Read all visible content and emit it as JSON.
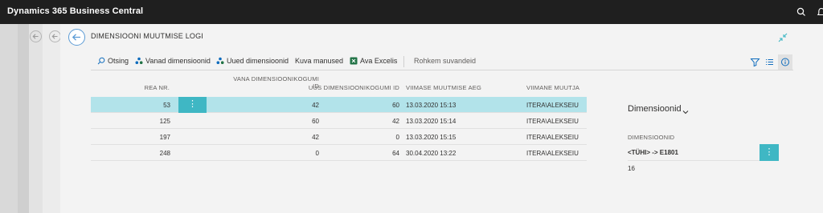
{
  "app": {
    "title": "Dynamics 365 Business Central"
  },
  "page": {
    "title": "DIMENSIOONI MUUTMISE LOGI"
  },
  "toolbar": {
    "items": [
      {
        "label": "Otsing",
        "icon": "search-icon"
      },
      {
        "label": "Vanad dimensioonid",
        "icon": "dimensions-icon"
      },
      {
        "label": "Uued dimensioonid",
        "icon": "dimensions-icon"
      },
      {
        "label": "Kuva manused",
        "icon": ""
      },
      {
        "label": "Ava Excelis",
        "icon": "excel-icon"
      }
    ],
    "more_label": "Rohkem suvandeid"
  },
  "grid": {
    "columns": {
      "line_no": "REA NR.",
      "old_dim_set_1": "VANA DIMENSIOONIKOGUMI",
      "old_dim_set_2": "ID",
      "new_dim_set": "UUS DIMENSIOONIKOGUMI ID",
      "last_modified": "VIIMASE MUUTMISE AEG",
      "last_modifier": "VIIMANE MUUTJA"
    },
    "rows": [
      {
        "line_no": "53",
        "old_id": "42",
        "new_id": "60",
        "modified": "13.03.2020 15:13",
        "user": "ITERA\\ALEKSEIU"
      },
      {
        "line_no": "125",
        "old_id": "60",
        "new_id": "42",
        "modified": "13.03.2020 15:14",
        "user": "ITERA\\ALEKSEIU"
      },
      {
        "line_no": "197",
        "old_id": "42",
        "new_id": "0",
        "modified": "13.03.2020 15:15",
        "user": "ITERA\\ALEKSEIU"
      },
      {
        "line_no": "248",
        "old_id": "0",
        "new_id": "64",
        "modified": "30.04.2020 13:22",
        "user": "ITERA\\ALEKSEIU"
      }
    ],
    "row_menu_glyph": "⋮"
  },
  "factbox": {
    "title": "Dimensioonid",
    "column": "DIMENSIOONID",
    "rows": [
      "<TÜHI> -> E1801",
      "16"
    ],
    "menu_glyph": "⋮"
  },
  "colors": {
    "topbar": "#1f1f1f",
    "selected_row": "#b2e3ea",
    "accent": "#3fb7c4",
    "back_button": "#5b9bd5",
    "excel": "#217346"
  }
}
